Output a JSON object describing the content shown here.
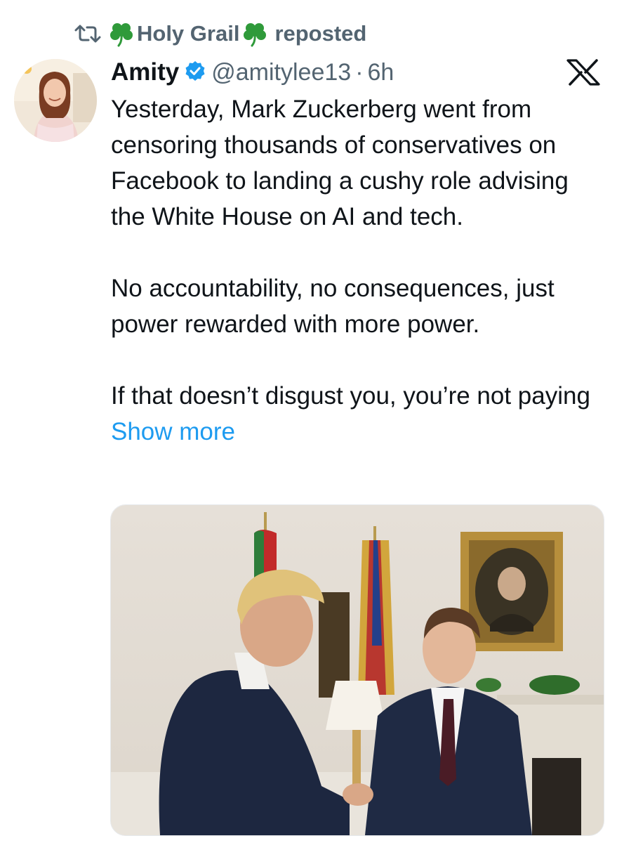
{
  "repost": {
    "reposter_name": "Holy Grail",
    "label": "reposted"
  },
  "author": {
    "display_name": "Amity",
    "handle": "@amitylee13",
    "separator": "·",
    "time": "6h"
  },
  "post": {
    "paragraph_1": "Yesterday, Mark Zuckerberg went from censoring thousands of conservatives on Facebook to landing a cushy role advising the White House on AI and tech.",
    "paragraph_2": "No accountability, no consequences, just power rewarded with more power.",
    "paragraph_3": "If that doesn’t disgust you, you’re not paying",
    "show_more": "Show more"
  },
  "icons": {
    "repost": "repost-icon",
    "shamrock": "shamrock-icon",
    "verified": "verified-badge-icon",
    "x": "x-logo-icon"
  },
  "colors": {
    "text": "#0f1419",
    "secondary": "#536471",
    "link": "#1d9bf0",
    "verified": "#1d9bf0",
    "shamrock": "#2f9a3a"
  }
}
